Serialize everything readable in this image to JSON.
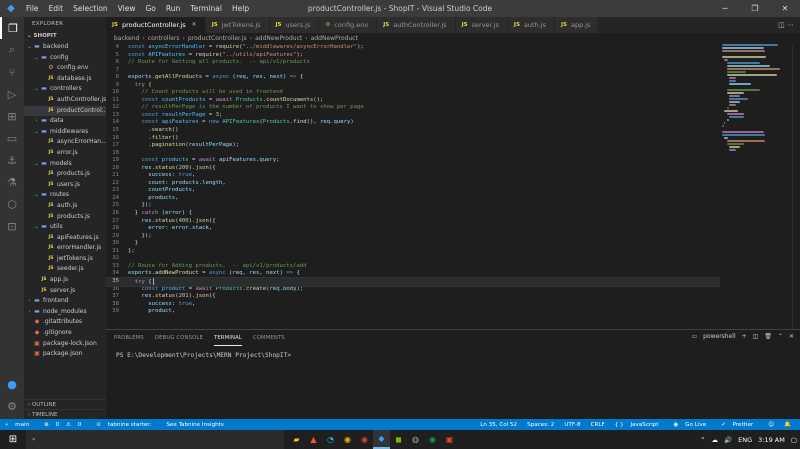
{
  "window": {
    "title": "productController.js - ShopIT - Visual Studio Code",
    "menu": [
      "File",
      "Edit",
      "Selection",
      "View",
      "Go",
      "Run",
      "Terminal",
      "Help"
    ]
  },
  "activity_icons": [
    "files-icon",
    "search-icon",
    "source-control-icon",
    "run-debug-icon",
    "extensions-icon",
    "remote-explorer-icon",
    "docker-icon",
    "testing-icon"
  ],
  "sidebar": {
    "header": "EXPLORER",
    "project": "SHOPIT",
    "tree": [
      {
        "label": "backend",
        "depth": 0,
        "type": "folder",
        "open": true
      },
      {
        "label": "config",
        "depth": 1,
        "type": "folder",
        "open": true
      },
      {
        "label": "config.env",
        "depth": 2,
        "type": "env"
      },
      {
        "label": "database.js",
        "depth": 2,
        "type": "js"
      },
      {
        "label": "controllers",
        "depth": 1,
        "type": "folder",
        "open": true
      },
      {
        "label": "authController.js",
        "depth": 2,
        "type": "js"
      },
      {
        "label": "productControl...",
        "depth": 2,
        "type": "js",
        "selected": true
      },
      {
        "label": "data",
        "depth": 1,
        "type": "folder",
        "open": false
      },
      {
        "label": "middlewares",
        "depth": 1,
        "type": "folder",
        "open": true
      },
      {
        "label": "asyncErrorHan...",
        "depth": 2,
        "type": "js"
      },
      {
        "label": "error.js",
        "depth": 2,
        "type": "js"
      },
      {
        "label": "models",
        "depth": 1,
        "type": "folder",
        "open": true
      },
      {
        "label": "products.js",
        "depth": 2,
        "type": "js"
      },
      {
        "label": "users.js",
        "depth": 2,
        "type": "js"
      },
      {
        "label": "routes",
        "depth": 1,
        "type": "folder",
        "open": true
      },
      {
        "label": "auth.js",
        "depth": 2,
        "type": "js"
      },
      {
        "label": "products.js",
        "depth": 2,
        "type": "js"
      },
      {
        "label": "utils",
        "depth": 1,
        "type": "folder",
        "open": true
      },
      {
        "label": "apiFeatures.js",
        "depth": 2,
        "type": "js"
      },
      {
        "label": "errorHandler.js",
        "depth": 2,
        "type": "js"
      },
      {
        "label": "jwtTokens.js",
        "depth": 2,
        "type": "js"
      },
      {
        "label": "seeder.js",
        "depth": 2,
        "type": "js"
      },
      {
        "label": "app.js",
        "depth": 1,
        "type": "js"
      },
      {
        "label": "server.js",
        "depth": 1,
        "type": "js"
      },
      {
        "label": "frontend",
        "depth": 0,
        "type": "folder",
        "open": false
      },
      {
        "label": "node_modules",
        "depth": 0,
        "type": "folder",
        "open": false
      },
      {
        "label": ".gitattributes",
        "depth": 0,
        "type": "git"
      },
      {
        "label": ".gitignore",
        "depth": 0,
        "type": "git"
      },
      {
        "label": "package-lock.json",
        "depth": 0,
        "type": "json"
      },
      {
        "label": "package.json",
        "depth": 0,
        "type": "json"
      }
    ],
    "outline": "OUTLINE",
    "timeline": "TIMELINE"
  },
  "tabs": [
    {
      "label": "productController.js",
      "active": true
    },
    {
      "label": "jwtTokens.js"
    },
    {
      "label": "users.js"
    },
    {
      "label": "config.env"
    },
    {
      "label": "authController.js"
    },
    {
      "label": "server.js"
    },
    {
      "label": "auth.js"
    },
    {
      "label": "app.js"
    }
  ],
  "breadcrumb": [
    "backend",
    "controllers",
    "productController.js",
    "addNewProduct",
    "addNewProduct"
  ],
  "code_lines": [
    {
      "n": "4",
      "html": "<span class='b'>const</span> <span class='c'>asyncErrorHandler</span> = <span class='f'>require</span>(<span class='s'>\"../middlewares/asyncErrorHandler\"</span>);"
    },
    {
      "n": "5",
      "html": "<span class='b'>const</span> <span class='c'>APIFeatures</span> = <span class='f'>require</span>(<span class='s'>\"../utils/apiFeatures\"</span>);"
    },
    {
      "n": "6",
      "html": "<span class='cm'>// Route for Getting all products.  -- api/v1/products</span>"
    },
    {
      "n": "7",
      "html": ""
    },
    {
      "n": "8",
      "html": "<span class='v'>exports</span>.<span class='f'>getAllProducts</span> = <span class='b'>async</span> (<span class='v'>req</span>, <span class='v'>res</span>, <span class='v'>next</span>) <span class='b'>=&gt;</span> {"
    },
    {
      "n": "9",
      "html": "  <span class='k'>try</span> {"
    },
    {
      "n": "10",
      "html": "    <span class='cm'>// Count products will be used in frontend</span>"
    },
    {
      "n": "11",
      "html": "    <span class='b'>const</span> <span class='c'>countProducts</span> = <span class='k'>await</span> <span class='t'>Products</span>.<span class='f'>countDocuments</span>();"
    },
    {
      "n": "12",
      "html": "    <span class='cm'>// resultPerPage is the number of products I want to show per page</span>"
    },
    {
      "n": "13",
      "html": "    <span class='b'>const</span> <span class='c'>resultPerPage</span> = <span class='n'>3</span>;"
    },
    {
      "n": "14",
      "html": "    <span class='b'>const</span> <span class='c'>apiFeatures</span> = <span class='b'>new</span> <span class='t'>APIFeatures</span>(<span class='t'>Products</span>.<span class='f'>find</span>(), <span class='v'>req</span>.<span class='v'>query</span>)"
    },
    {
      "n": "15",
      "html": "      .<span class='f'>search</span>()"
    },
    {
      "n": "16",
      "html": "      .<span class='f'>filter</span>()"
    },
    {
      "n": "17",
      "html": "      .<span class='f'>pagination</span>(<span class='v'>resultPerPage</span>);"
    },
    {
      "n": "18",
      "html": ""
    },
    {
      "n": "19",
      "html": "    <span class='b'>const</span> <span class='c'>products</span> = <span class='k'>await</span> <span class='v'>apiFeatures</span>.<span class='v'>query</span>;"
    },
    {
      "n": "20",
      "html": "    <span class='v'>res</span>.<span class='f'>status</span>(<span class='n'>200</span>).<span class='f'>json</span>({"
    },
    {
      "n": "21",
      "html": "      <span class='v'>success</span>: <span class='b'>true</span>,"
    },
    {
      "n": "22",
      "html": "      <span class='v'>count</span>: <span class='v'>products</span>.<span class='v'>length</span>,"
    },
    {
      "n": "23",
      "html": "      <span class='v'>countProducts</span>,"
    },
    {
      "n": "24",
      "html": "      <span class='v'>products</span>,"
    },
    {
      "n": "25",
      "html": "    });"
    },
    {
      "n": "26",
      "html": "  } <span class='k'>catch</span> (<span class='v'>error</span>) {"
    },
    {
      "n": "27",
      "html": "    <span class='v'>res</span>.<span class='f'>status</span>(<span class='n'>400</span>).<span class='f'>json</span>({"
    },
    {
      "n": "28",
      "html": "      <span class='v'>error</span>: <span class='v'>error</span>.<span class='v'>stack</span>,"
    },
    {
      "n": "29",
      "html": "    });"
    },
    {
      "n": "30",
      "html": "  }"
    },
    {
      "n": "31",
      "html": "};"
    },
    {
      "n": "32",
      "html": ""
    },
    {
      "n": "33",
      "html": "<span class='cm'>// Route for Adding products.  -- api/v1/products/add</span>"
    },
    {
      "n": "34",
      "html": "<span class='v'>exports</span>.<span class='f'>addNewProduct</span> = <span class='b'>async</span> (<span class='v'>req</span>, <span class='v'>res</span>, <span class='v'>next</span>) <span class='b'>=&gt;</span> {"
    },
    {
      "n": "35",
      "html": "  <span class='k'>try</span> {",
      "current": true
    },
    {
      "n": "36",
      "html": "    <span class='b'>const</span> <span class='c'>product</span> = <span class='k'>await</span> <span class='t'>Products</span>.<span class='f'>create</span>(<span class='v'>req</span>.<span class='v'>body</span>);"
    },
    {
      "n": "37",
      "html": "    <span class='v'>res</span>.<span class='f'>status</span>(<span class='n'>201</span>).<span class='f'>json</span>({"
    },
    {
      "n": "38",
      "html": "      <span class='v'>success</span>: <span class='b'>true</span>,"
    },
    {
      "n": "39",
      "html": "      <span class='v'>product</span>,"
    }
  ],
  "panel": {
    "tabs": [
      "PROBLEMS",
      "DEBUG CONSOLE",
      "TERMINAL",
      "COMMENTS"
    ],
    "active_tab": "TERMINAL",
    "shell": "powershell",
    "prompt": "PS E:\\Development\\Projects\\MERN Project\\ShopIT>"
  },
  "statusbar": {
    "branch": "main",
    "errors": "0",
    "warnings": "0",
    "tabnine": "tabnine starter:",
    "tabnine_insights": "See Tabnine Insights",
    "position": "Ln 35, Col 52",
    "spaces": "Spaces: 2",
    "encoding": "UTF-8",
    "eol": "CRLF",
    "language": "JavaScript",
    "golive": "Go Live",
    "prettier": "Prettier"
  },
  "taskbar": {
    "time": "3:19 AM",
    "language": "ENG"
  }
}
